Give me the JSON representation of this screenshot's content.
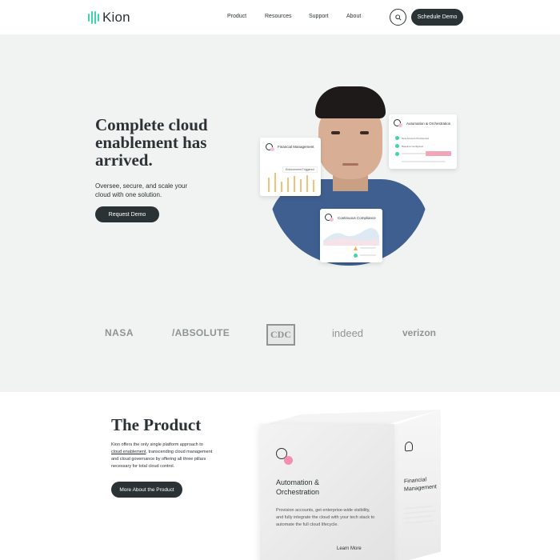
{
  "header": {
    "brand": "Kion",
    "nav": [
      "Product",
      "Resources",
      "Support",
      "About"
    ],
    "cta_label": "Schedule Demo",
    "search_icon": "search-icon"
  },
  "hero": {
    "title": "Complete cloud enablement has arrived.",
    "subtitle": "Oversee, secure, and scale your cloud with one solution.",
    "cta_label": "Request Demo",
    "cards": {
      "financial": {
        "title": "Financial Management",
        "tag": "Enforcement Triggered"
      },
      "automation": {
        "title": "Automation & Orchestration",
        "items": [
          "New Account Provisioned",
          "Baseline Configured"
        ]
      },
      "compliance": {
        "title": "Continuous Compliance"
      }
    }
  },
  "logos": [
    "NASA",
    "/ABSOLUTE",
    "CDC",
    "indeed",
    "verizon"
  ],
  "product": {
    "title": "The Product",
    "text_before": "Kion offers the only single platform approach to ",
    "text_link": "cloud enablement",
    "text_after": ", transcending cloud management and cloud governance by offering all three pillars necessary for total cloud control.",
    "cta_label": "More About the Product",
    "box": {
      "front_title": "Automation & Orchestration",
      "front_text": "Provision accounts, get enterprise-wide visibility, and fully integrate the cloud with your tech stack to automate the full cloud lifecycle.",
      "front_link": "Learn More",
      "side_title": "Financial Management"
    }
  },
  "colors": {
    "dark": "#2b3235",
    "accent": "#3dd6a7",
    "hero_bg": "#f0f3f1",
    "pink": "#f48fb1",
    "chart_bar": "#f2c27b"
  }
}
